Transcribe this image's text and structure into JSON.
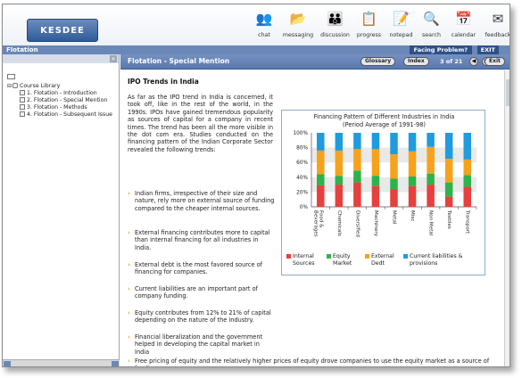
{
  "app": {
    "logo_text": "KESDEE",
    "section": "Flotation",
    "facing_problem": "Facing Problem?",
    "exit_top": "EXIT"
  },
  "toolbar": [
    {
      "label": "chat",
      "icon": "chat-icon"
    },
    {
      "label": "messaging",
      "icon": "messaging-icon"
    },
    {
      "label": "discussion",
      "icon": "discussion-icon"
    },
    {
      "label": "progress",
      "icon": "progress-icon"
    },
    {
      "label": "notepad",
      "icon": "notepad-icon"
    },
    {
      "label": "search",
      "icon": "search-icon"
    },
    {
      "label": "calendar",
      "icon": "calendar-icon"
    },
    {
      "label": "feedback",
      "icon": "feedback-icon"
    }
  ],
  "sidebar": {
    "root": "Course Library",
    "items": [
      "1. Flotation - Introduction",
      "2. Flotation - Special Mention",
      "3. Flotation - Methods",
      "4. Flotation - Subsequent Issue"
    ]
  },
  "main": {
    "title": "Flotation - Special Mention",
    "glossary": "Glossary",
    "index": "Index",
    "page": "3 of 21",
    "exit": "Exit",
    "heading": "IPO Trends in India",
    "intro": "As far as the IPO trend in India is concerned, it took off, like in the rest of the world, in the 1990s. IPOs have gained tremendous popularity as sources of capital for a company in recent times. The trend has been all the more visible in the dot com era. Studies conducted on the financing pattern of the Indian Corporate Sector revealed the following trends:",
    "bullets": [
      "Indian firms, irrespective of their size and nature, rely more on external source of funding compared to the cheaper internal sources.",
      "External financing contributes more to capital than internal financing for all industries in India.",
      "External debt is the most favored source of financing for companies.",
      "Current liabilities are an important part of company funding.",
      "Equity contributes from 12% to 21% of capital depending on the nature of the industry.",
      "Financial liberalization and the government helped in developing the capital market in India",
      "Free pricing of equity and the relatively higher prices of equity drove companies to use the equity market as a source of funding."
    ]
  },
  "chart_data": {
    "type": "bar",
    "stacked": true,
    "title": "Financing Pattern of Different Industries in India",
    "subtitle": "(Period Average of 1991-98)",
    "categories": [
      "Food & Beverages",
      "Chemicals",
      "Diversified",
      "Machinery",
      "Metal",
      "Misc",
      "Non Metal",
      "Textiles",
      "Transport"
    ],
    "ylim": [
      0,
      100
    ],
    "yticks": [
      "0%",
      "20%",
      "40%",
      "60%",
      "80%",
      "100%"
    ],
    "series": [
      {
        "name": "Internal Sources",
        "color": "#e8403c",
        "values": [
          29,
          30,
          33,
          28,
          24,
          28,
          30,
          14,
          27
        ]
      },
      {
        "name": "Equity Market",
        "color": "#2db34a",
        "values": [
          15,
          12,
          16,
          14,
          14,
          13,
          15,
          19,
          16
        ]
      },
      {
        "name": "External Dedt",
        "color": "#f7a21b",
        "values": [
          32,
          34,
          29,
          36,
          33,
          34,
          36,
          32,
          21
        ]
      },
      {
        "name": "Current liabilities & provisions",
        "color": "#1f9be0",
        "values": [
          24,
          24,
          22,
          22,
          29,
          25,
          19,
          35,
          36
        ]
      }
    ],
    "legend_position": "bottom"
  }
}
